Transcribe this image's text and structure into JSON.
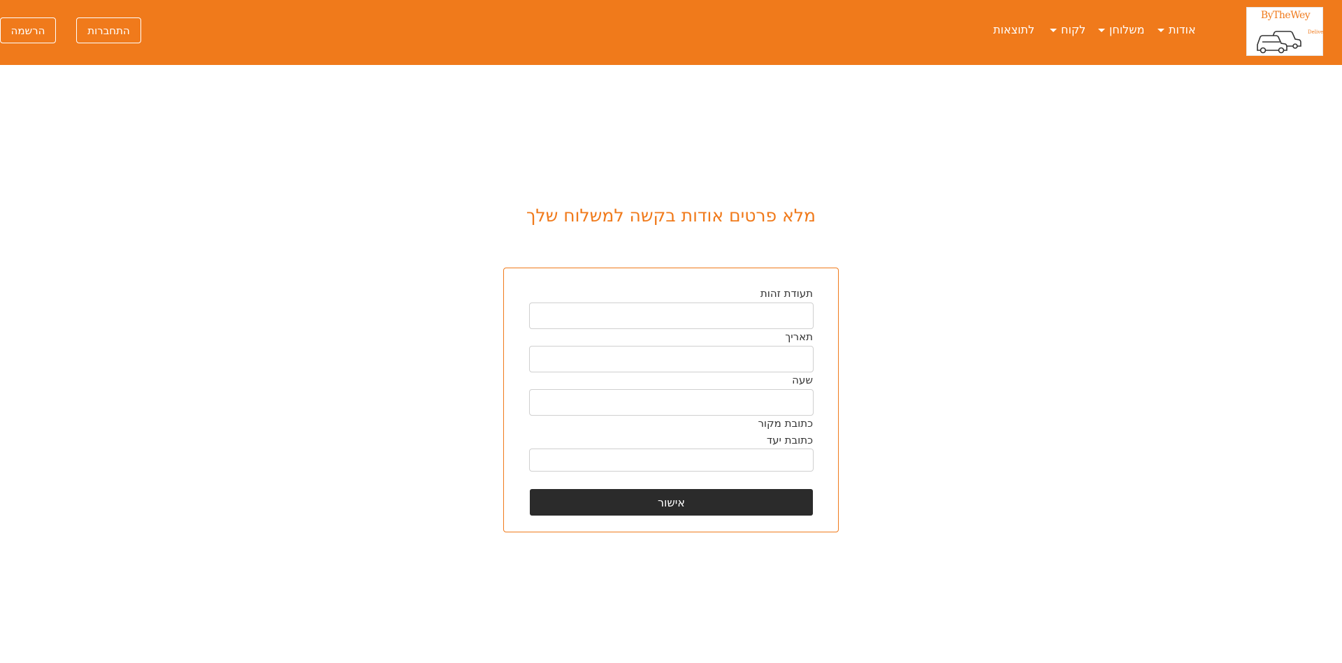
{
  "brand": {
    "logo_text": "ByTheWey",
    "logo_subtext": "Deliver",
    "logo_icon": "cars-icon"
  },
  "nav": {
    "items": [
      {
        "label": "אודות",
        "dropdown": true
      },
      {
        "label": "משלוחן",
        "dropdown": true
      },
      {
        "label": "לקוח",
        "dropdown": true
      },
      {
        "label": "לתוצאות",
        "dropdown": false
      }
    ],
    "login_label": "התחברות",
    "register_label": "הרשמה"
  },
  "page": {
    "title": "מלא פרטים אודות בקשה למשלוח שלך"
  },
  "form": {
    "fields": [
      {
        "label": "תעודת זהות",
        "value": ""
      },
      {
        "label": "תאריך",
        "value": ""
      },
      {
        "label": "שעה",
        "value": ""
      },
      {
        "label": "כתובת מקור"
      },
      {
        "label": "כתובת יעד",
        "value": ""
      }
    ],
    "submit_label": "אישור"
  },
  "colors": {
    "accent": "#f07a1b",
    "button_dark": "#2b2b2b",
    "white": "#ffffff"
  }
}
